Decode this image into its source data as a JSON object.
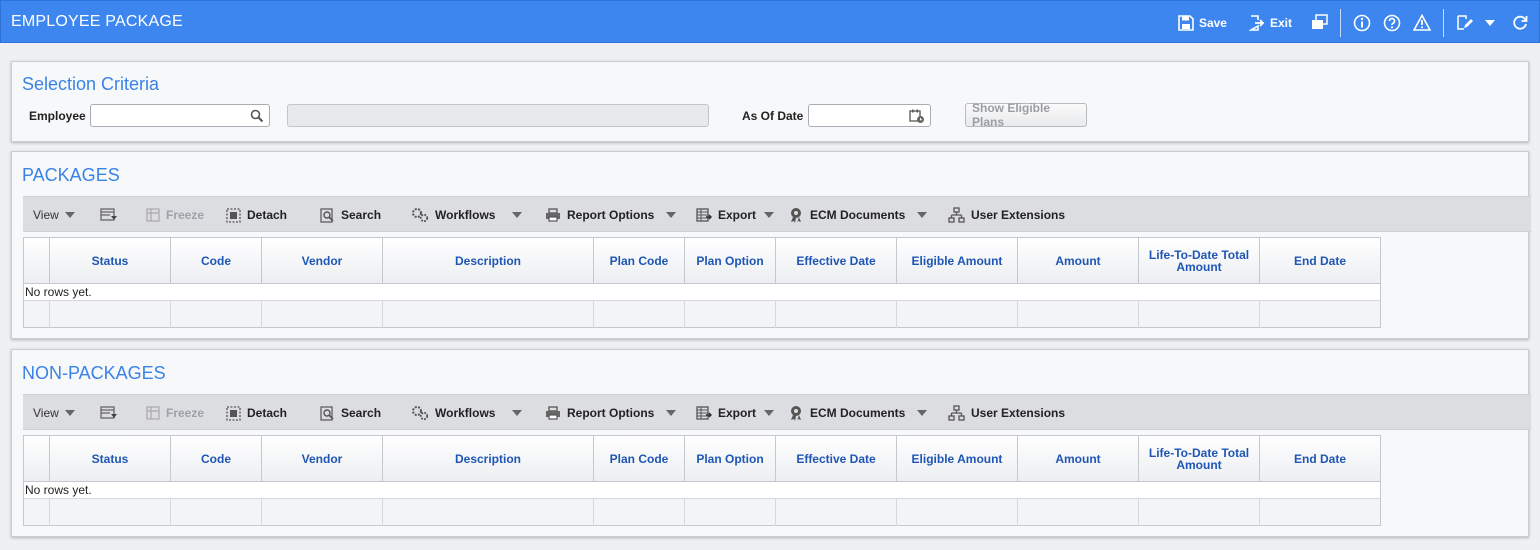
{
  "app": {
    "title": "EMPLOYEE PACKAGE"
  },
  "titlebar": {
    "save_label": "Save",
    "exit_label": "Exit"
  },
  "selection": {
    "title": "Selection Criteria",
    "employee_label": "Employee",
    "employee_value": "",
    "employee_name": "",
    "as_of_date_label": "As Of Date",
    "as_of_date_value": "",
    "show_eligible_plans_label": "Show Eligible Plans"
  },
  "toolbar": {
    "view": "View",
    "freeze": "Freeze",
    "detach": "Detach",
    "search": "Search",
    "workflows": "Workflows",
    "report_options": "Report Options",
    "export": "Export",
    "ecm_documents": "ECM Documents",
    "user_extensions": "User Extensions"
  },
  "columns": [
    "Status",
    "Code",
    "Vendor",
    "Description",
    "Plan Code",
    "Plan Option",
    "Effective Date",
    "Eligible Amount",
    "Amount",
    "Life-To-Date Total Amount",
    "End Date"
  ],
  "packages": {
    "title": "PACKAGES",
    "empty_text": "No rows yet."
  },
  "non_packages": {
    "title": "NON-PACKAGES",
    "empty_text": "No rows yet."
  }
}
